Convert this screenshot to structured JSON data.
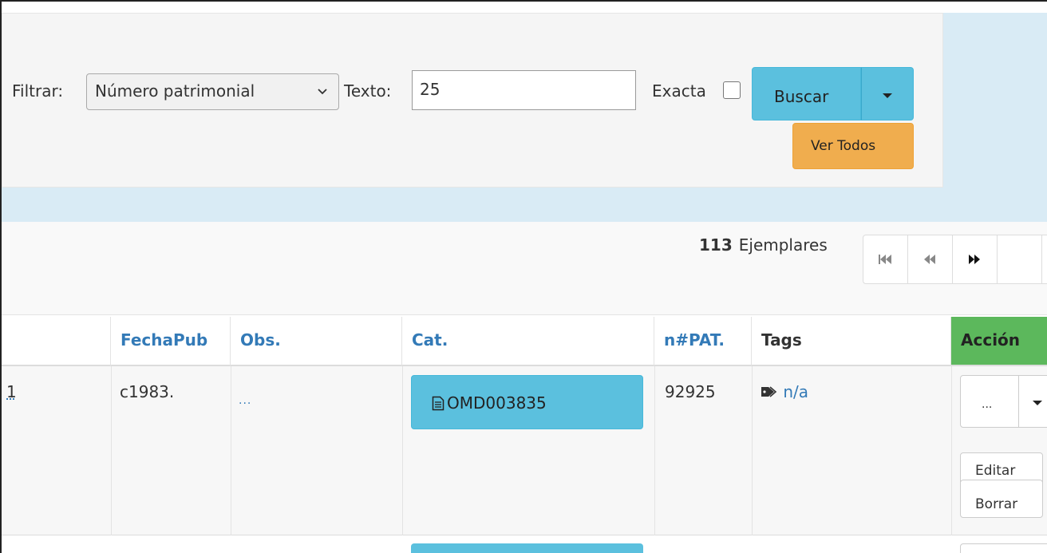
{
  "filter": {
    "filter_label": "Filtrar:",
    "filter_select_value": "Número patrimonial",
    "text_label": "Texto:",
    "text_value": "25",
    "exact_label": "Exacta",
    "exact_checked": false,
    "search_button": "Buscar",
    "show_all_button": "Ver Todos"
  },
  "results": {
    "count": "113",
    "count_label": "Ejemplares"
  },
  "table": {
    "headers": {
      "fechapub": "FechaPub",
      "obs": "Obs.",
      "cat": "Cat.",
      "npat": "n#PAT.",
      "tags": "Tags",
      "accion": "Acción"
    },
    "rows": [
      {
        "col0_partial": "1",
        "fechapub": "c1983.",
        "obs": "...",
        "cat": "OMD003835",
        "npat": "92925",
        "tags": "n/a",
        "action_dots": "...",
        "edit": "Editar",
        "delete": "Borrar"
      }
    ]
  },
  "icons": {
    "select_chevron": "chevron-down-icon",
    "search_dropdown": "caret-down-icon",
    "first_page": "fast-backward-icon",
    "prev_page": "backward-icon",
    "next_page": "forward-icon",
    "cat_doc": "file-text-icon",
    "tag": "tag-icon",
    "action_dropdown": "caret-down-icon"
  },
  "colors": {
    "info_button": "#5bc0de",
    "warning_button": "#f0ad4e",
    "success_header": "#5cb85c",
    "link": "#337ab7",
    "filter_band": "#d9ebf5"
  }
}
